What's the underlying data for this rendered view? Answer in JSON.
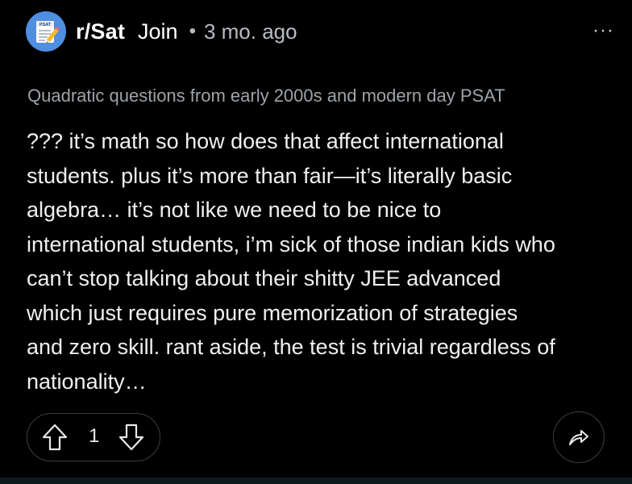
{
  "post": {
    "subreddit": "r/Sat",
    "join_label": "Join",
    "separator": "•",
    "time_ago": "3 mo. ago",
    "more_label": "···",
    "context_title": "Quadratic questions from early 2000s and modern day PSAT",
    "body_lines": [
      "??? it’s math so how does that affect international",
      "students. plus it’s more than fair—it’s literally basic",
      "algebra… it’s not like we need to be nice to",
      "international students, i’m sick of those indian kids who",
      "can’t stop talking about their shitty JEE advanced",
      "which just requires pure memorization of strategies",
      "and zero skill. rant aside, the test is trivial regardless of",
      "nationality…"
    ],
    "vote_count": "1",
    "avatar_label": "PSAT"
  },
  "colors": {
    "background": "#000000",
    "avatar_bg": "#4f8ee0",
    "muted_text": "#9ea3a8",
    "border": "#3a3d40"
  },
  "icons": {
    "avatar": "psat-notepad-icon",
    "upvote": "upvote-arrow-icon",
    "downvote": "downvote-arrow-icon",
    "share": "share-arrow-icon",
    "more": "more-dots-icon"
  }
}
